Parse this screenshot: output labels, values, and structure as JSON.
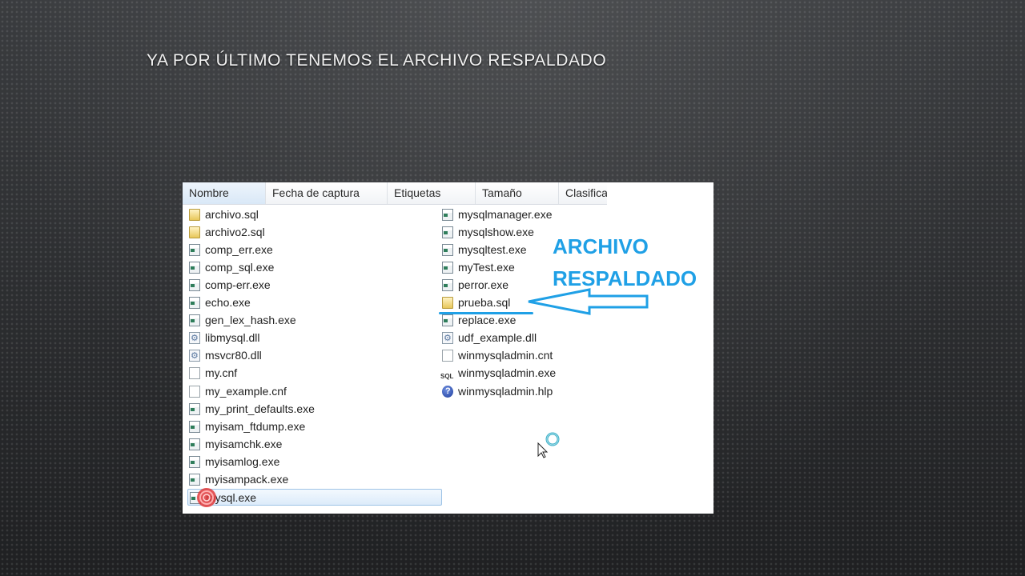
{
  "slide": {
    "title": "YA POR ÚLTIMO TENEMOS EL ARCHIVO RESPALDADO"
  },
  "explorer": {
    "columns": [
      "Nombre",
      "Fecha de captura",
      "Etiquetas",
      "Tamaño",
      "Clasifica"
    ],
    "left_files": [
      {
        "name": "archivo.sql",
        "icon": "sql-file-icon"
      },
      {
        "name": "archivo2.sql",
        "icon": "sql-file-icon"
      },
      {
        "name": "comp_err.exe",
        "icon": "exe-file-icon"
      },
      {
        "name": "comp_sql.exe",
        "icon": "exe-file-icon"
      },
      {
        "name": "comp-err.exe",
        "icon": "exe-file-icon"
      },
      {
        "name": "echo.exe",
        "icon": "exe-file-icon"
      },
      {
        "name": "gen_lex_hash.exe",
        "icon": "exe-file-icon"
      },
      {
        "name": "libmysql.dll",
        "icon": "dll-file-icon"
      },
      {
        "name": "msvcr80.dll",
        "icon": "dll-file-icon"
      },
      {
        "name": "my.cnf",
        "icon": "document-icon"
      },
      {
        "name": "my_example.cnf",
        "icon": "document-icon"
      },
      {
        "name": "my_print_defaults.exe",
        "icon": "exe-file-icon"
      },
      {
        "name": "myisam_ftdump.exe",
        "icon": "exe-file-icon"
      },
      {
        "name": "myisamchk.exe",
        "icon": "exe-file-icon"
      },
      {
        "name": "myisamlog.exe",
        "icon": "exe-file-icon"
      },
      {
        "name": "myisampack.exe",
        "icon": "exe-file-icon"
      },
      {
        "name": "mysql.exe",
        "icon": "exe-file-icon"
      }
    ],
    "right_files": [
      {
        "name": "mysqlmanager.exe",
        "icon": "exe-file-icon"
      },
      {
        "name": "mysqlshow.exe",
        "icon": "exe-file-icon"
      },
      {
        "name": "mysqltest.exe",
        "icon": "exe-file-icon"
      },
      {
        "name": "myTest.exe",
        "icon": "exe-file-icon"
      },
      {
        "name": "perror.exe",
        "icon": "exe-file-icon"
      },
      {
        "name": "prueba.sql",
        "icon": "sql-file-icon"
      },
      {
        "name": "replace.exe",
        "icon": "exe-file-icon"
      },
      {
        "name": "udf_example.dll",
        "icon": "dll-file-icon"
      },
      {
        "name": "winmysqladmin.cnt",
        "icon": "document-icon"
      },
      {
        "name": "winmysqladmin.exe",
        "icon": "sql-app-icon"
      },
      {
        "name": "winmysqladmin.hlp",
        "icon": "help-file-icon"
      }
    ],
    "selected_file": "mysql.exe"
  },
  "annotation": {
    "line1": "ARCHIVO",
    "line2": "RESPALDADO",
    "color": "#1fa0e6"
  }
}
